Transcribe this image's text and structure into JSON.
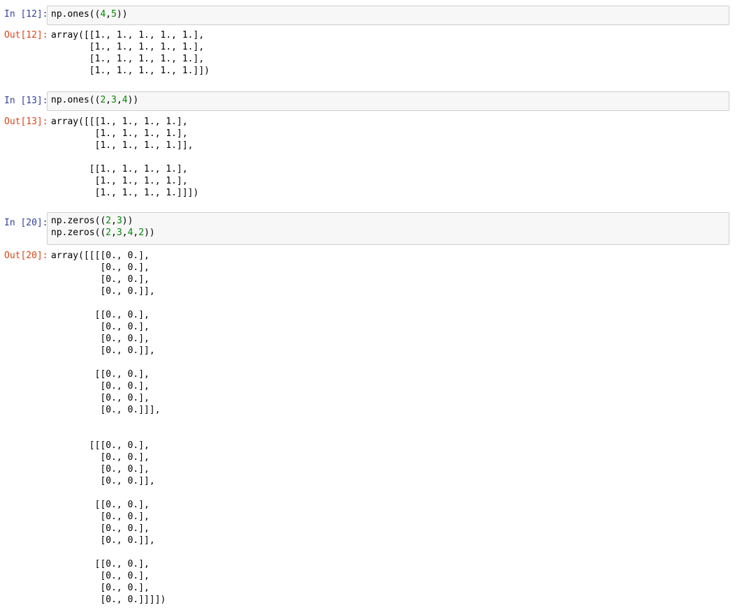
{
  "cells": [
    {
      "in_prompt": "In [12]:",
      "out_prompt": "Out[12]:",
      "code": [
        [
          {
            "t": "np.ones(("
          },
          {
            "t": "4",
            "n": true
          },
          {
            "t": ","
          },
          {
            "t": "5",
            "n": true
          },
          {
            "t": "))"
          }
        ]
      ],
      "output": [
        "array([[1., 1., 1., 1., 1.],",
        "       [1., 1., 1., 1., 1.],",
        "       [1., 1., 1., 1., 1.],",
        "       [1., 1., 1., 1., 1.]])"
      ]
    },
    {
      "in_prompt": "In [13]:",
      "out_prompt": "Out[13]:",
      "code": [
        [
          {
            "t": "np.ones(("
          },
          {
            "t": "2",
            "n": true
          },
          {
            "t": ","
          },
          {
            "t": "3",
            "n": true
          },
          {
            "t": ","
          },
          {
            "t": "4",
            "n": true
          },
          {
            "t": "))"
          }
        ]
      ],
      "output": [
        "array([[[1., 1., 1., 1.],",
        "        [1., 1., 1., 1.],",
        "        [1., 1., 1., 1.]],",
        "",
        "       [[1., 1., 1., 1.],",
        "        [1., 1., 1., 1.],",
        "        [1., 1., 1., 1.]]])"
      ]
    },
    {
      "in_prompt": "In [20]:",
      "out_prompt": "Out[20]:",
      "code": [
        [
          {
            "t": "np.zeros(("
          },
          {
            "t": "2",
            "n": true
          },
          {
            "t": ","
          },
          {
            "t": "3",
            "n": true
          },
          {
            "t": "))"
          }
        ],
        [
          {
            "t": "np.zeros(("
          },
          {
            "t": "2",
            "n": true
          },
          {
            "t": ","
          },
          {
            "t": "3",
            "n": true
          },
          {
            "t": ","
          },
          {
            "t": "4",
            "n": true
          },
          {
            "t": ","
          },
          {
            "t": "2",
            "n": true
          },
          {
            "t": "))"
          }
        ]
      ],
      "output": [
        "array([[[[0., 0.],",
        "         [0., 0.],",
        "         [0., 0.],",
        "         [0., 0.]],",
        "",
        "        [[0., 0.],",
        "         [0., 0.],",
        "         [0., 0.],",
        "         [0., 0.]],",
        "",
        "        [[0., 0.],",
        "         [0., 0.],",
        "         [0., 0.],",
        "         [0., 0.]]],",
        "",
        "",
        "       [[[0., 0.],",
        "         [0., 0.],",
        "         [0., 0.],",
        "         [0., 0.]],",
        "",
        "        [[0., 0.],",
        "         [0., 0.],",
        "         [0., 0.],",
        "         [0., 0.]],",
        "",
        "        [[0., 0.],",
        "         [0., 0.],",
        "         [0., 0.],",
        "         [0., 0.]]]])"
      ]
    }
  ],
  "colors": {
    "in_prompt": "#303f9f",
    "out_prompt": "#d84315",
    "number_literal": "#008800",
    "input_background": "#f7f7f7",
    "input_border": "#cfcfcf"
  }
}
